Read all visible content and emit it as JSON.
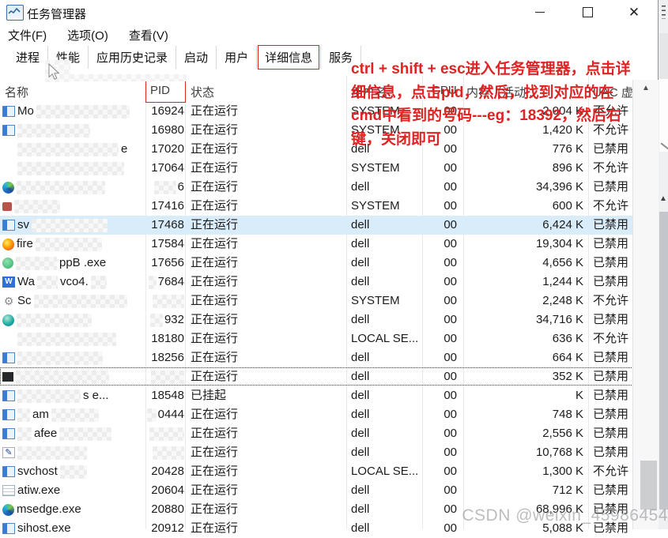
{
  "window": {
    "title": "任务管理器",
    "controls": [
      {
        "name": "minimize"
      },
      {
        "name": "maximize"
      },
      {
        "name": "close"
      }
    ]
  },
  "menu": [
    "文件(F)",
    "选项(O)",
    "查看(V)"
  ],
  "tabs": {
    "items": [
      "进程",
      "性能",
      "应用历史记录",
      "启动",
      "用户",
      "详细信息",
      "服务"
    ],
    "active": "详细信息"
  },
  "annotation": {
    "color": "#e02222",
    "lines": [
      "ctrl + shift + esc进入任务管理器，点击详",
      "细信息，点击pid，然后，找到对应的在",
      "cmd中看到的号码---eg：18392，然后右",
      "键，关闭即可"
    ]
  },
  "table": {
    "columns": [
      {
        "key": "name",
        "label": "名称"
      },
      {
        "key": "pid",
        "label": "PID",
        "sort_indicator": "^",
        "highlight_box": true
      },
      {
        "key": "status",
        "label": "状态"
      },
      {
        "key": "user",
        "label": "用户名"
      },
      {
        "key": "cpu",
        "label": "CPU"
      },
      {
        "key": "mem",
        "label": "内存（活动..."
      },
      {
        "key": "uac",
        "label": "UAC 虚拟化"
      }
    ],
    "rows": [
      {
        "icon": "app-window",
        "name": [
          {
            "t": "Mo"
          },
          {
            "m": 118
          }
        ],
        "pid": [
          {
            "t": "16924"
          }
        ],
        "status": "正在运行",
        "user": "SYSTEM",
        "cpu": "00",
        "mem": [
          {
            "t": "2,004 K"
          }
        ],
        "uac": "不允许"
      },
      {
        "icon": "app-window",
        "name": [
          {
            "m": 92
          }
        ],
        "pid": [
          {
            "t": "16980"
          }
        ],
        "status": "正在运行",
        "user": "SYSTEM",
        "cpu": "00",
        "mem": [
          {
            "t": "1,420 K"
          }
        ],
        "uac": "不允许"
      },
      {
        "icon": "none",
        "name": [
          {
            "m": 128
          },
          {
            "t": "e"
          }
        ],
        "pid": [
          {
            "t": "17020"
          }
        ],
        "status": "正在运行",
        "user": "dell",
        "cpu": "00",
        "mem": [
          {
            "t": "776 K"
          }
        ],
        "uac": "已禁用"
      },
      {
        "icon": "none",
        "name": [
          {
            "m": 135
          }
        ],
        "pid": [
          {
            "t": "17064"
          }
        ],
        "status": "正在运行",
        "user": "SYSTEM",
        "cpu": "00",
        "mem": [
          {
            "t": "896 K"
          }
        ],
        "uac": "不允许"
      },
      {
        "icon": "edge",
        "name": [
          {
            "m": 112
          }
        ],
        "pid": [
          {
            "m": 28
          },
          {
            "t": "6"
          }
        ],
        "status": "正在运行",
        "user": "dell",
        "cpu": "00",
        "mem": [
          {
            "t": "34,396 K"
          }
        ],
        "uac": "已禁用"
      },
      {
        "icon": "red-app",
        "name": [
          {
            "m": 58
          }
        ],
        "pid": [
          {
            "t": "17416"
          }
        ],
        "status": "正在运行",
        "user": "SYSTEM",
        "cpu": "00",
        "mem": [
          {
            "t": "600 K"
          }
        ],
        "uac": "不允许"
      },
      {
        "icon": "app-window",
        "name": [
          {
            "t": "sv"
          },
          {
            "m": 96
          }
        ],
        "pid": [
          {
            "t": "17468"
          }
        ],
        "status": "正在运行",
        "user": "dell",
        "cpu": "00",
        "mem": [
          {
            "t": "6,424 K"
          }
        ],
        "uac": "已禁用",
        "highlight": true
      },
      {
        "icon": "firefox",
        "name": [
          {
            "t": "fire"
          },
          {
            "m": 84
          }
        ],
        "pid": [
          {
            "t": "17584"
          }
        ],
        "status": "正在运行",
        "user": "dell",
        "cpu": "00",
        "mem": [
          {
            "t": "19,304 K"
          }
        ],
        "uac": "已禁用"
      },
      {
        "icon": "green-app",
        "name": [
          {
            "m": 52
          },
          {
            "t": "ppB .exe"
          }
        ],
        "pid": [
          {
            "t": "17656"
          }
        ],
        "status": "正在运行",
        "user": "dell",
        "cpu": "00",
        "mem": [
          {
            "t": "4,656 K"
          }
        ],
        "uac": "已禁用"
      },
      {
        "icon": "wave",
        "name": [
          {
            "t": "Wa"
          },
          {
            "m": 26
          },
          {
            "t": "vco4."
          },
          {
            "m": 20
          }
        ],
        "pid": [
          {
            "m": 10
          },
          {
            "t": "7684"
          }
        ],
        "status": "正在运行",
        "user": "dell",
        "cpu": "00",
        "mem": [
          {
            "t": "1,244 K"
          }
        ],
        "uac": "已禁用"
      },
      {
        "icon": "gears",
        "name": [
          {
            "t": "Sc"
          },
          {
            "m": 118
          }
        ],
        "pid": [
          {
            "m": 40
          }
        ],
        "status": "正在运行",
        "user": "SYSTEM",
        "cpu": "00",
        "mem": [
          {
            "t": "2,248 K"
          }
        ],
        "uac": "不允许"
      },
      {
        "icon": "teal-globe",
        "name": [
          {
            "m": 95
          }
        ],
        "pid": [
          {
            "m": 16
          },
          {
            "t": "932"
          }
        ],
        "status": "正在运行",
        "user": "dell",
        "cpu": "00",
        "mem": [
          {
            "t": "34,716 K"
          }
        ],
        "uac": "已禁用"
      },
      {
        "icon": "none",
        "name": [
          {
            "m": 125
          }
        ],
        "pid": [
          {
            "t": "18180"
          }
        ],
        "status": "正在运行",
        "user": "LOCAL SE...",
        "cpu": "00",
        "mem": [
          {
            "t": "636 K"
          }
        ],
        "uac": "不允许"
      },
      {
        "icon": "app-window",
        "name": [
          {
            "m": 108
          }
        ],
        "pid": [
          {
            "t": "18256"
          }
        ],
        "status": "正在运行",
        "user": "dell",
        "cpu": "00",
        "mem": [
          {
            "t": "664 K"
          }
        ],
        "uac": "已禁用"
      },
      {
        "icon": "black-app",
        "name": [
          {
            "m": 118
          }
        ],
        "pid": [
          {
            "m": 42
          }
        ],
        "status": "正在运行",
        "user": "dell",
        "cpu": "00",
        "mem": [
          {
            "t": "352 K"
          }
        ],
        "uac": "已禁用",
        "dotted": true
      },
      {
        "icon": "app-window",
        "name": [
          {
            "m": 80
          },
          {
            "t": "s e..."
          }
        ],
        "pid": [
          {
            "t": "18548"
          }
        ],
        "status": "已挂起",
        "user": "dell",
        "cpu": "00",
        "mem": [
          {
            "t": "K"
          }
        ],
        "uac": "已禁用"
      },
      {
        "icon": "app-window",
        "name": [
          {
            "m": 16
          },
          {
            "t": "am"
          },
          {
            "m": 60
          }
        ],
        "pid": [
          {
            "m": 12
          },
          {
            "t": "0444"
          }
        ],
        "status": "正在运行",
        "user": "dell",
        "cpu": "00",
        "mem": [
          {
            "t": "748 K"
          }
        ],
        "uac": "已禁用"
      },
      {
        "icon": "app-window",
        "name": [
          {
            "m": 18
          },
          {
            "t": "afee"
          },
          {
            "m": 66
          }
        ],
        "pid": [
          {
            "m": 44
          }
        ],
        "status": "正在运行",
        "user": "dell",
        "cpu": "00",
        "mem": [
          {
            "t": "2,556 K"
          }
        ],
        "uac": "已禁用"
      },
      {
        "icon": "pencil",
        "name": [
          {
            "m": 88
          }
        ],
        "pid": [
          {
            "m": 40
          }
        ],
        "status": "正在运行",
        "user": "dell",
        "cpu": "00",
        "mem": [
          {
            "t": "10,768 K"
          }
        ],
        "uac": "已禁用"
      },
      {
        "icon": "app-window",
        "name": [
          {
            "t": "svchost"
          },
          {
            "m": 34
          }
        ],
        "pid": [
          {
            "t": "20428"
          }
        ],
        "status": "正在运行",
        "user": "LOCAL SE...",
        "cpu": "00",
        "mem": [
          {
            "t": "1,300 K"
          }
        ],
        "uac": "不允许"
      },
      {
        "icon": "document",
        "name": [
          {
            "t": "atiw.exe"
          }
        ],
        "pid": [
          {
            "t": "20604"
          }
        ],
        "status": "正在运行",
        "user": "dell",
        "cpu": "00",
        "mem": [
          {
            "t": "712 K"
          }
        ],
        "uac": "已禁用"
      },
      {
        "icon": "edge",
        "name": [
          {
            "t": "msedge.exe"
          }
        ],
        "pid": [
          {
            "t": "20880"
          }
        ],
        "status": "正在运行",
        "user": "dell",
        "cpu": "00",
        "mem": [
          {
            "t": "68,996 K"
          }
        ],
        "uac": "已禁用"
      },
      {
        "icon": "app-window",
        "name": [
          {
            "t": "sihost.exe"
          }
        ],
        "pid": [
          {
            "t": "20912"
          }
        ],
        "status": "正在运行",
        "user": "dell",
        "cpu": "00",
        "mem": [
          {
            "t": "5,088 K"
          }
        ],
        "uac": "已禁用"
      }
    ]
  },
  "watermark": "CSDN @weixin_45986454",
  "colors": {
    "annotation_red": "#e02222",
    "row_highlight": "#d9ecf9"
  }
}
